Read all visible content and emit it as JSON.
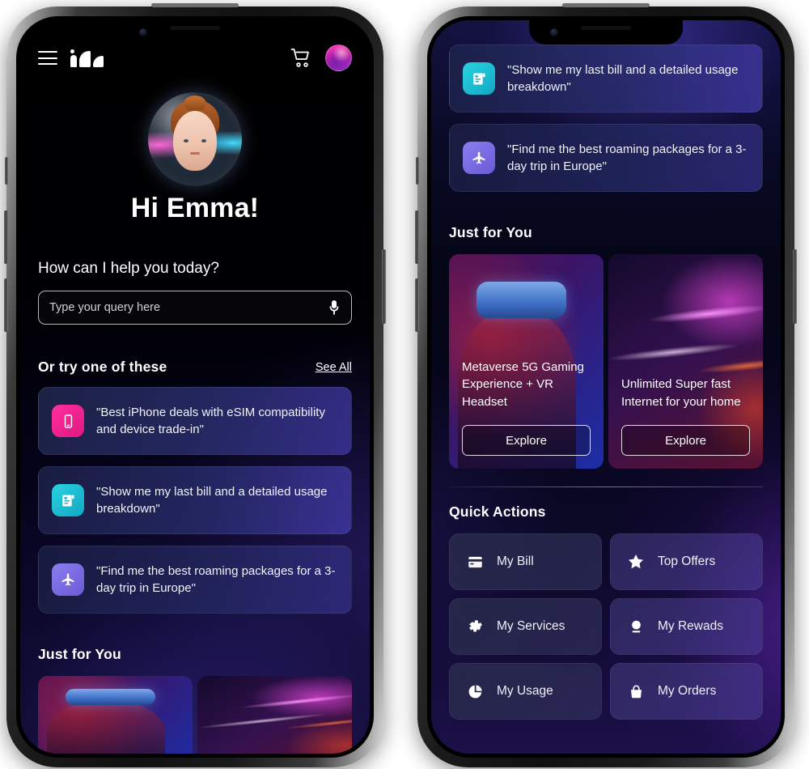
{
  "header": {
    "menu_icon": "hamburger-menu-icon",
    "logo": "brand-logo",
    "cart_icon": "shopping-cart-icon",
    "avatar": "user-avatar"
  },
  "hero": {
    "avatar_alt": "assistant-orb-avatar",
    "greeting": "Hi Emma!"
  },
  "assistant": {
    "prompt": "How can I help you today?",
    "search_placeholder": "Type your query here",
    "search_value": "",
    "mic_icon": "microphone-icon"
  },
  "suggestions": {
    "title": "Or try one of these",
    "see_all": "See All",
    "items": [
      {
        "icon": "mobile-phone-icon",
        "color": "#ff2fa0",
        "text": "\"Best iPhone deals with eSIM compatibility and device trade-in\""
      },
      {
        "icon": "bill-document-icon",
        "color": "#2ad2e0",
        "text": "\"Show me my last bill and a detailed usage breakdown\""
      },
      {
        "icon": "airplane-icon",
        "color": "#8b7df0",
        "text": "\"Find me the best roaming packages for a 3-day trip in Europe\""
      }
    ]
  },
  "just_for_you": {
    "title": "Just for You",
    "cards": [
      {
        "title": "Metaverse 5G Gaming Experience + VR Headset",
        "cta": "Explore",
        "image": "vr-headset-photo"
      },
      {
        "title": "Unlimited Super fast Internet for your home",
        "cta": "Explore",
        "image": "neon-waves-photo"
      }
    ]
  },
  "quick_actions": {
    "title": "Quick Actions",
    "items": [
      {
        "label": "My Bill",
        "icon": "credit-card-icon"
      },
      {
        "label": "Top Offers",
        "icon": "star-icon"
      },
      {
        "label": "My Services",
        "icon": "gear-icon"
      },
      {
        "label": "My Rewads",
        "icon": "award-medal-icon"
      },
      {
        "label": "My Usage",
        "icon": "pie-chart-icon"
      },
      {
        "label": "My Orders",
        "icon": "shopping-bag-icon"
      }
    ]
  },
  "theme": {
    "accent_pink": "#ff2fa0",
    "accent_teal": "#2ad2e0",
    "accent_purple": "#8b7df0",
    "background": "#050617"
  }
}
